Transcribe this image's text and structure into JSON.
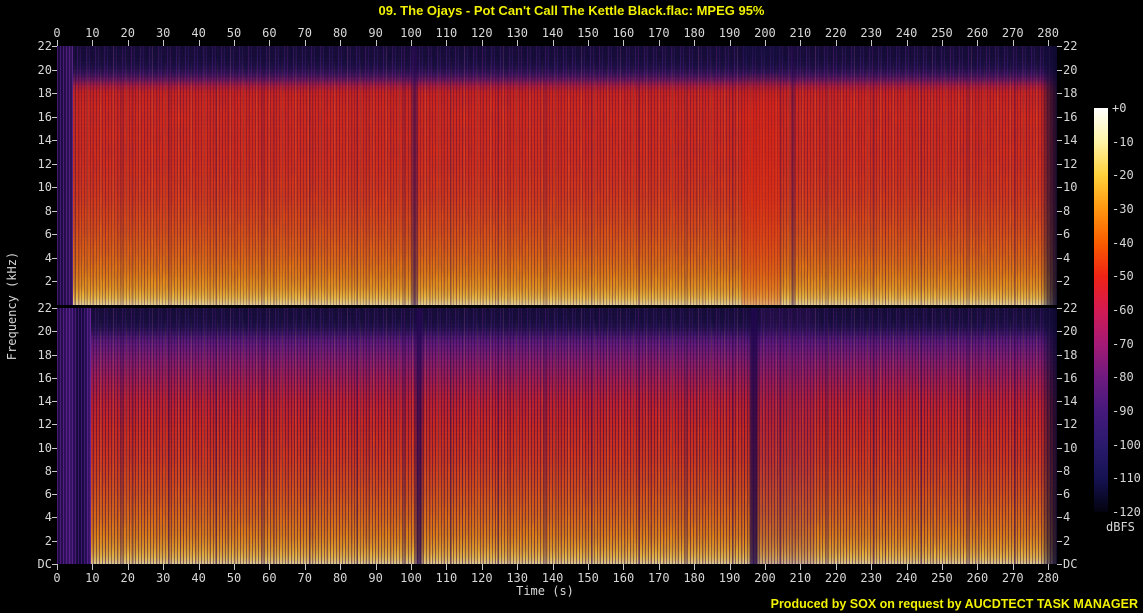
{
  "header": {
    "title": "09. The Ojays - Pot Can't Call The Kettle Black.flac: MPEG 95%"
  },
  "footer": {
    "credit": "Produced by SOX on request by AUCDTECT TASK MANAGER"
  },
  "chart_data": {
    "type": "heatmap",
    "subtype": "audio-spectrogram-stereo",
    "title": "09. The Ojays - Pot Can't Call The Kettle Black.flac: MPEG 95%",
    "xlabel": "Time (s)",
    "ylabel": "Frequency (kHz)",
    "x_ticks": [
      0,
      10,
      20,
      30,
      40,
      50,
      60,
      70,
      80,
      90,
      100,
      110,
      120,
      130,
      140,
      150,
      160,
      170,
      180,
      190,
      200,
      210,
      220,
      230,
      240,
      250,
      260,
      270,
      280
    ],
    "x_range_s": [
      0,
      282.5
    ],
    "y_ticks_khz": [
      22,
      20,
      18,
      16,
      14,
      12,
      10,
      8,
      6,
      4,
      2
    ],
    "y_dc_label": "DC",
    "y_range_khz": [
      0,
      22
    ],
    "panels": [
      {
        "name": "left-channel"
      },
      {
        "name": "right-channel"
      }
    ],
    "colorbar": {
      "label": "dBFS",
      "ticks": [
        "+0",
        "-10",
        "-20",
        "-30",
        "-40",
        "-50",
        "-60",
        "-70",
        "-80",
        "-90",
        "-100",
        "-110",
        "-120"
      ],
      "range_db": [
        0,
        -120
      ],
      "gradient": {
        "+0": "#ffffff",
        "-10": "#fff4a6",
        "-20": "#ffd03a",
        "-30": "#ff9710",
        "-40": "#fa5d00",
        "-50": "#ef2315",
        "-60": "#d31a52",
        "-70": "#a51a74",
        "-80": "#6f1a80",
        "-90": "#45197c",
        "-100": "#2a1a6e",
        "-110": "#151252",
        "-120": "#000000"
      },
      "position": "right"
    },
    "features": [
      "High-frequency energy shelf cut near 20.5 kHz on both channels (MPEG 95% lossy encoding)",
      "Quiet purple intro: ~0-4 s on left channel, ~0-9 s on right channel",
      "Narrow quiet gaps (dark vertical streaks) near 102 s and 196 s",
      "Softer breakdown section around 194-210 s",
      "Fade-out to silence after ~278 s",
      "Dense vertical transient striping throughout; strongest on right channel",
      "Bright -10..-30 dBFS band below ~2 kHz for the whole track"
    ],
    "layout": {
      "grid": false,
      "legend": "colorbar-right",
      "panels_stacked": true
    }
  },
  "colors": {
    "background": "#000000",
    "title_text": "#f2f200",
    "axis_text": "#d8d8d8",
    "credit_text": "#f2f200"
  }
}
